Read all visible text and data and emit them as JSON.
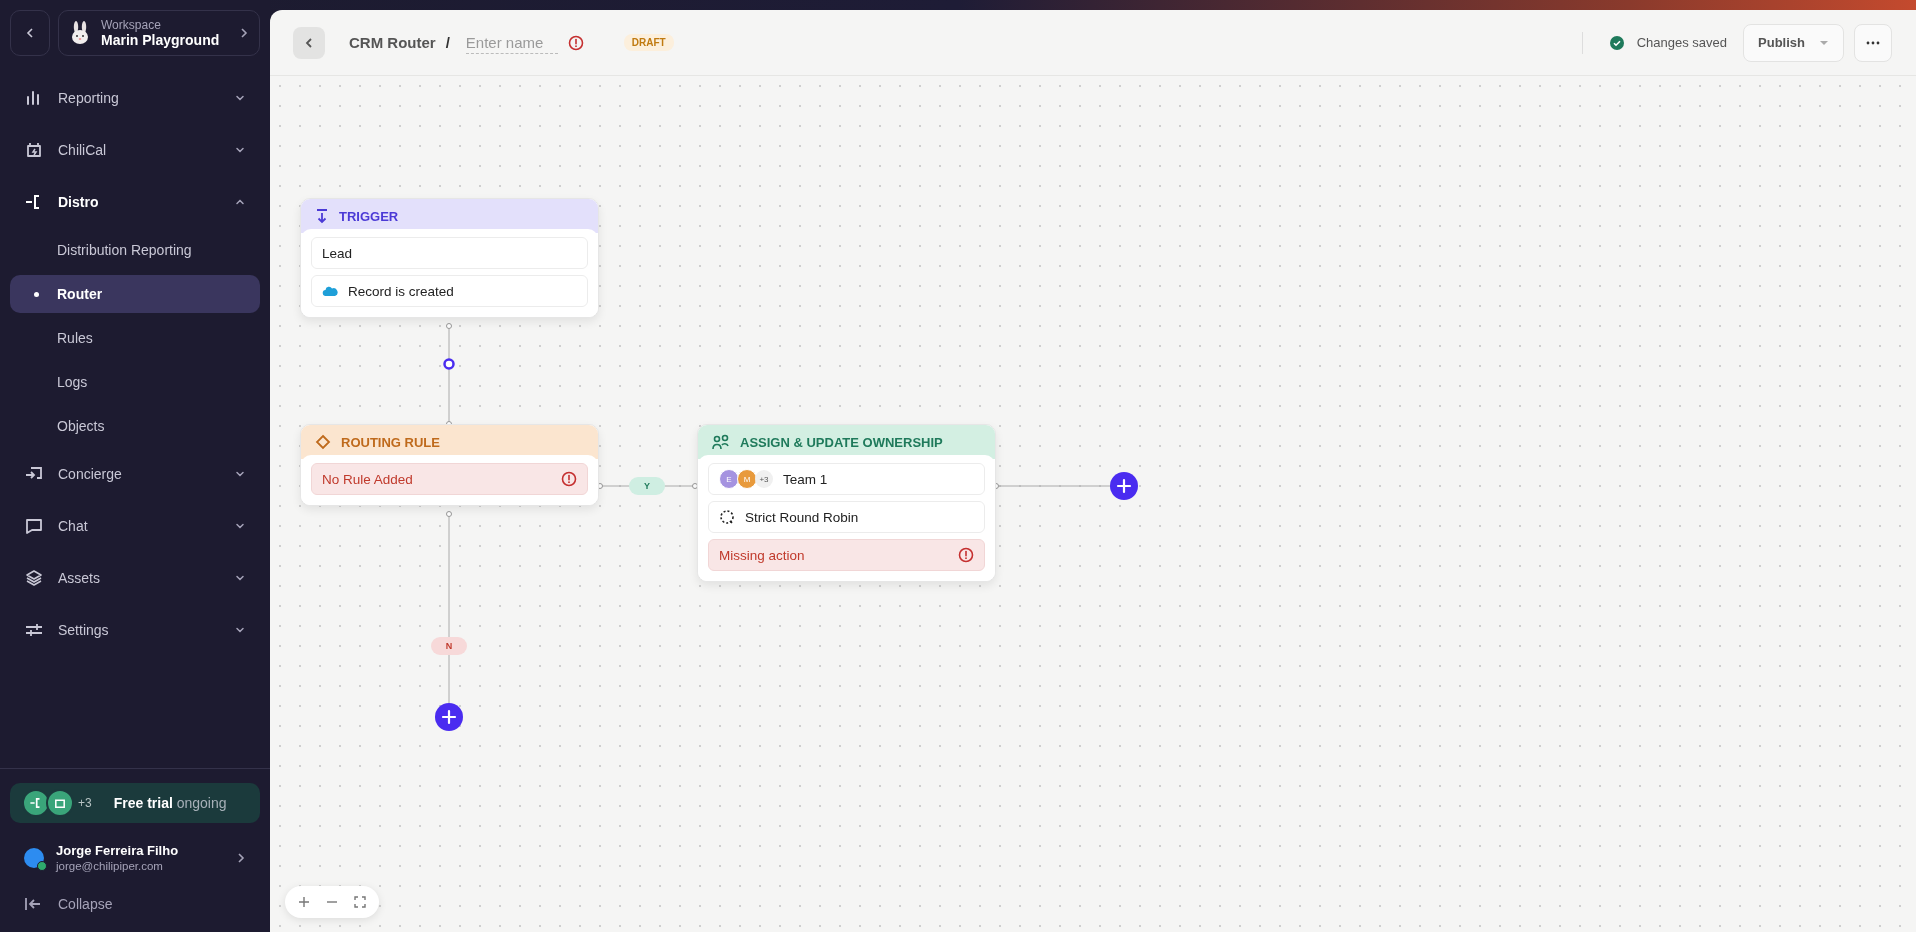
{
  "sidebar": {
    "workspace": {
      "label": "Workspace",
      "name": "Marin Playground"
    },
    "nav": [
      {
        "label": "Reporting",
        "expanded": false,
        "selected": false
      },
      {
        "label": "ChiliCal",
        "expanded": false,
        "selected": false
      },
      {
        "label": "Distro",
        "expanded": true,
        "selected": false,
        "children": [
          {
            "label": "Distribution Reporting",
            "selected": false
          },
          {
            "label": "Router",
            "selected": true
          },
          {
            "label": "Rules",
            "selected": false
          },
          {
            "label": "Logs",
            "selected": false
          },
          {
            "label": "Objects",
            "selected": false
          }
        ]
      },
      {
        "label": "Concierge",
        "expanded": false,
        "selected": false
      },
      {
        "label": "Chat",
        "expanded": false,
        "selected": false
      },
      {
        "label": "Assets",
        "expanded": false,
        "selected": false
      },
      {
        "label": "Settings",
        "expanded": false,
        "selected": false
      }
    ],
    "trial": {
      "count": "+3",
      "title": "Free trial",
      "status": "ongoing"
    },
    "user": {
      "name": "Jorge Ferreira Filho",
      "email": "jorge@chilipiper.com"
    },
    "collapse": "Collapse"
  },
  "header": {
    "title": "CRM Router",
    "separator": "/",
    "name_placeholder": "Enter name",
    "badge": "DRAFT",
    "status": "Changes saved",
    "publish": "Publish"
  },
  "canvas": {
    "nodes": [
      {
        "kind": "trigger",
        "title": "TRIGGER",
        "rows": [
          {
            "kind": "plain",
            "text": "Lead"
          },
          {
            "kind": "source",
            "text": "Record is created"
          }
        ]
      },
      {
        "kind": "rule",
        "title": "ROUTING RULE",
        "rows": [
          {
            "kind": "error",
            "text": "No Rule Added"
          }
        ]
      },
      {
        "kind": "assign",
        "title": "ASSIGN & UPDATE OWNERSHIP",
        "rows": [
          {
            "kind": "team",
            "avatars": [
              "E",
              "M"
            ],
            "more": "+3",
            "text": "Team 1"
          },
          {
            "kind": "method",
            "text": "Strict Round Robin"
          },
          {
            "kind": "error",
            "text": "Missing action"
          }
        ]
      }
    ],
    "branches": [
      {
        "kind": "yes",
        "label": "Y"
      },
      {
        "kind": "no",
        "label": "N"
      }
    ]
  }
}
